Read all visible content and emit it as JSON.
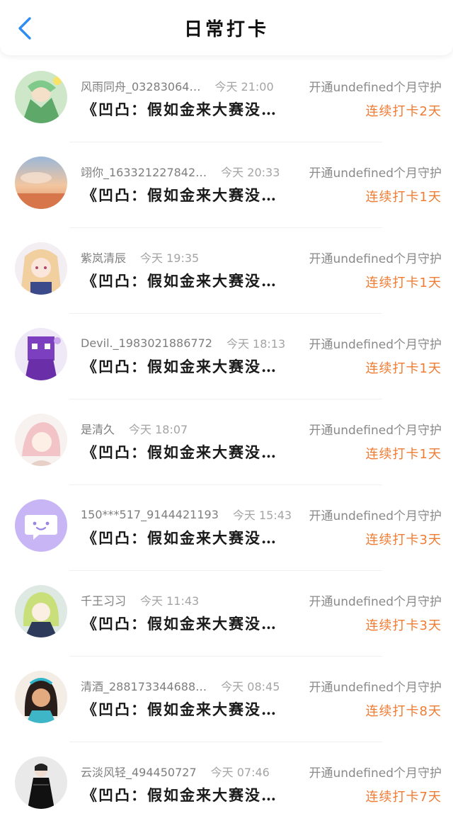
{
  "header": {
    "title": "日常打卡"
  },
  "items": [
    {
      "name": "风雨同舟_03283064…",
      "time": "今天 21:00",
      "guard": "开通undefined个月守护",
      "book": "《凹凸：假如金来大赛没…",
      "streak": "连续打卡2天"
    },
    {
      "name": "翊你_163321227842…",
      "time": "今天 20:33",
      "guard": "开通undefined个月守护",
      "book": "《凹凸：假如金来大赛没…",
      "streak": "连续打卡1天"
    },
    {
      "name": "紫岚清辰",
      "time": "今天 19:35",
      "guard": "开通undefined个月守护",
      "book": "《凹凸：假如金来大赛没…",
      "streak": "连续打卡1天"
    },
    {
      "name": "Devil._1983021886772",
      "time": "今天 18:13",
      "guard": "开通undefined个月守护",
      "book": "《凹凸：假如金来大赛没…",
      "streak": "连续打卡1天"
    },
    {
      "name": "是清久",
      "time": "今天 18:07",
      "guard": "开通undefined个月守护",
      "book": "《凹凸：假如金来大赛没…",
      "streak": "连续打卡1天"
    },
    {
      "name": "150***517_9144421193",
      "time": "今天 15:43",
      "guard": "开通undefined个月守护",
      "book": "《凹凸：假如金来大赛没…",
      "streak": "连续打卡3天"
    },
    {
      "name": "千王习习",
      "time": "今天 11:43",
      "guard": "开通undefined个月守护",
      "book": "《凹凸：假如金来大赛没…",
      "streak": "连续打卡3天"
    },
    {
      "name": "清酒_288173344688…",
      "time": "今天 08:45",
      "guard": "开通undefined个月守护",
      "book": "《凹凸：假如金来大赛没…",
      "streak": "连续打卡8天"
    },
    {
      "name": "云淡风轻_494450727",
      "time": "今天 07:46",
      "guard": "开通undefined个月守护",
      "book": "《凹凸：假如金来大赛没…",
      "streak": "连续打卡7天"
    }
  ],
  "colors": {
    "accent": "#f07b33",
    "back": "#2f8cf2",
    "placeholder_avatar": "#c8b5f5"
  },
  "icons": {
    "back": "chevron-left-icon",
    "default_avatar": "chat-bubble-icon"
  }
}
